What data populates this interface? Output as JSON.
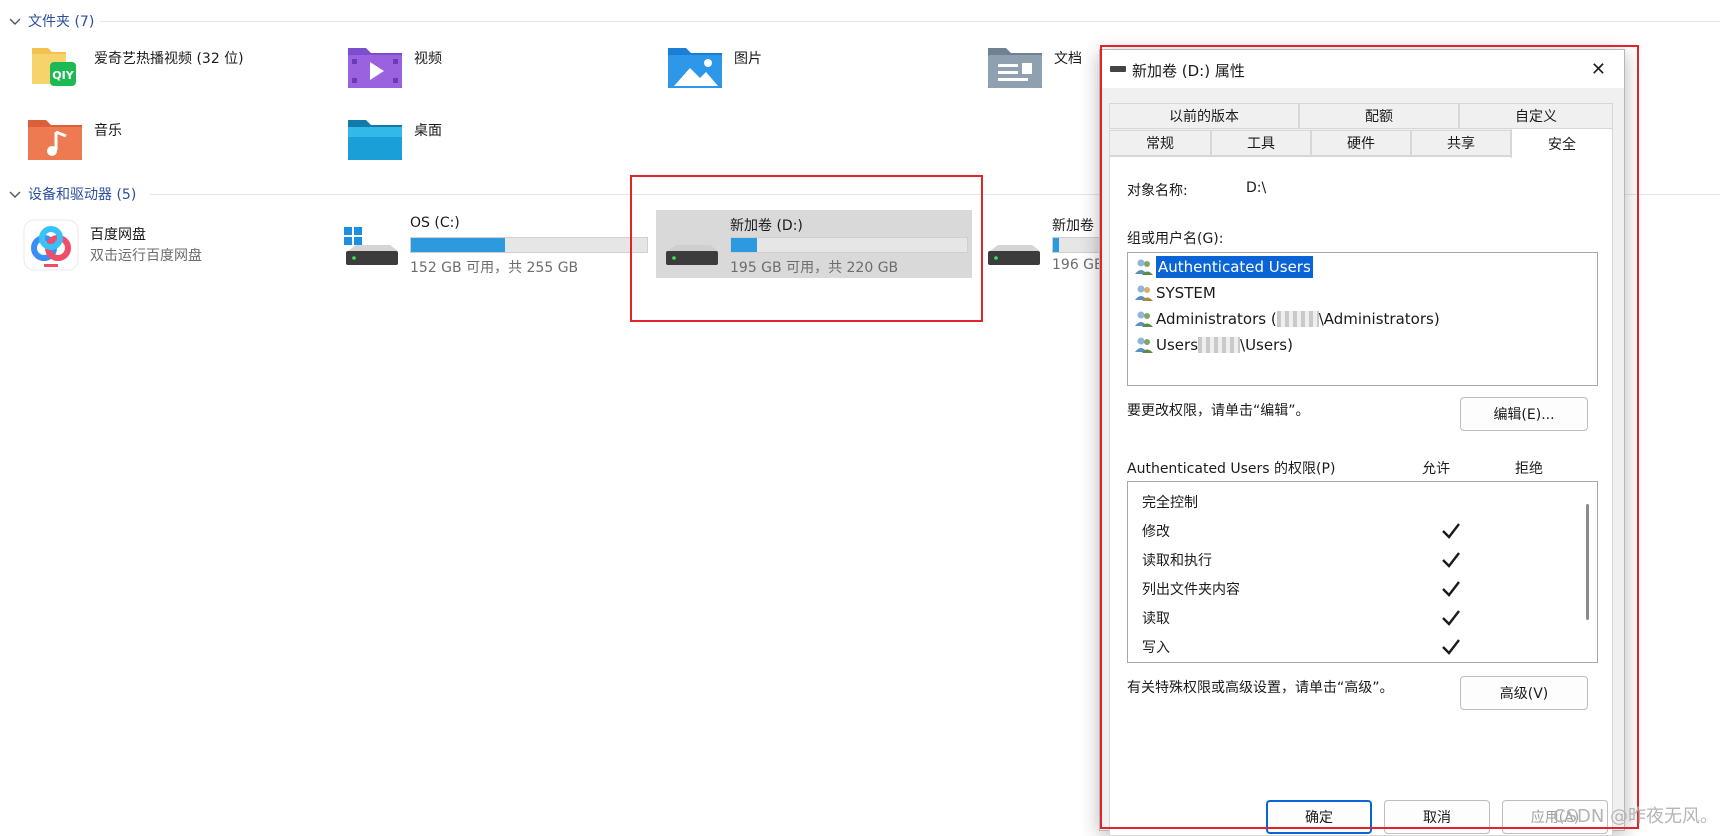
{
  "groups": {
    "folders_header": "文件夹 (7)",
    "drives_header": "设备和驱动器 (5)"
  },
  "folders": [
    {
      "label": "爱奇艺热播视频 (32 位)",
      "icon": "iqiyi-folder-icon"
    },
    {
      "label": "视频",
      "icon": "videos-folder-icon"
    },
    {
      "label": "图片",
      "icon": "pictures-folder-icon"
    },
    {
      "label": "文档",
      "icon": "documents-folder-icon"
    },
    {
      "label": "音乐",
      "icon": "music-folder-icon"
    },
    {
      "label": "桌面",
      "icon": "desktop-folder-icon"
    }
  ],
  "baidu": {
    "name": "百度网盘",
    "desc": "双击运行百度网盘"
  },
  "drives": [
    {
      "name": "OS (C:)",
      "free": "152 GB 可用，共 255 GB",
      "used_fraction": 0.4
    },
    {
      "name": "新加卷 (D:)",
      "free": "195 GB 可用，共 220 GB",
      "used_fraction": 0.11
    },
    {
      "name": "新加卷",
      "free": "196 GB",
      "used_fraction": 0.11
    }
  ],
  "dialog": {
    "title": "新加卷 (D:) 属性",
    "close": "✕",
    "tabs_row1": [
      "以前的版本",
      "配额",
      "自定义"
    ],
    "tabs_row2": [
      "常规",
      "工具",
      "硬件",
      "共享",
      "安全"
    ],
    "active_tab": "安全",
    "object_label": "对象名称:",
    "object_value": "D:\\",
    "group_label": "组或用户名(G):",
    "users": [
      {
        "name": "Authenticated Users"
      },
      {
        "name": "SYSTEM"
      },
      {
        "name": "Administrators (",
        "suffix": "\\Administrators)"
      },
      {
        "name": "Users ",
        "suffix": "\\Users)"
      }
    ],
    "edit_hint": "要更改权限，请单击“编辑”。",
    "edit_button": "编辑(E)...",
    "perm_title": "Authenticated Users 的权限(P)",
    "allow_col": "允许",
    "deny_col": "拒绝",
    "permissions": [
      {
        "name": "完全控制",
        "allow": false
      },
      {
        "name": "修改",
        "allow": true
      },
      {
        "name": "读取和执行",
        "allow": true
      },
      {
        "name": "列出文件夹内容",
        "allow": true
      },
      {
        "name": "读取",
        "allow": true
      },
      {
        "name": "写入",
        "allow": true
      }
    ],
    "advanced_hint": "有关特殊权限或高级设置，请单击“高级”。",
    "advanced_button": "高级(V)",
    "ok_button": "确定",
    "cancel_button": "取消",
    "apply_button": "应用(A)"
  },
  "watermark": "CSDN @昨夜无风。"
}
